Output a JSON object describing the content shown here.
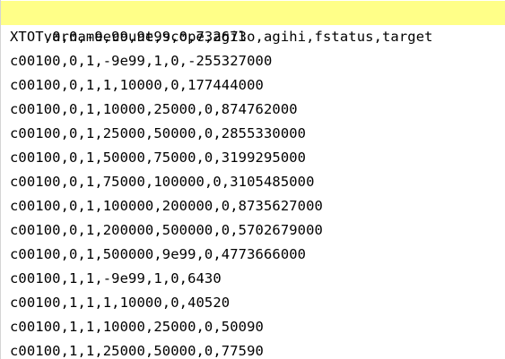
{
  "editor": {
    "highlight_color": "#ffff88",
    "lines": [
      "varname,count,scope,agilo,agihi,fstatus,target",
      "XTOT,0,0,-9e99,9e99,0,732673",
      "c00100,0,1,-9e99,1,0,-255327000",
      "c00100,0,1,1,10000,0,177444000",
      "c00100,0,1,10000,25000,0,874762000",
      "c00100,0,1,25000,50000,0,2855330000",
      "c00100,0,1,50000,75000,0,3199295000",
      "c00100,0,1,75000,100000,0,3105485000",
      "c00100,0,1,100000,200000,0,8735627000",
      "c00100,0,1,200000,500000,0,5702679000",
      "c00100,0,1,500000,9e99,0,4773666000",
      "c00100,1,1,-9e99,1,0,6430",
      "c00100,1,1,1,10000,0,40520",
      "c00100,1,1,10000,25000,0,50090",
      "c00100,1,1,25000,50000,0,77590"
    ]
  }
}
